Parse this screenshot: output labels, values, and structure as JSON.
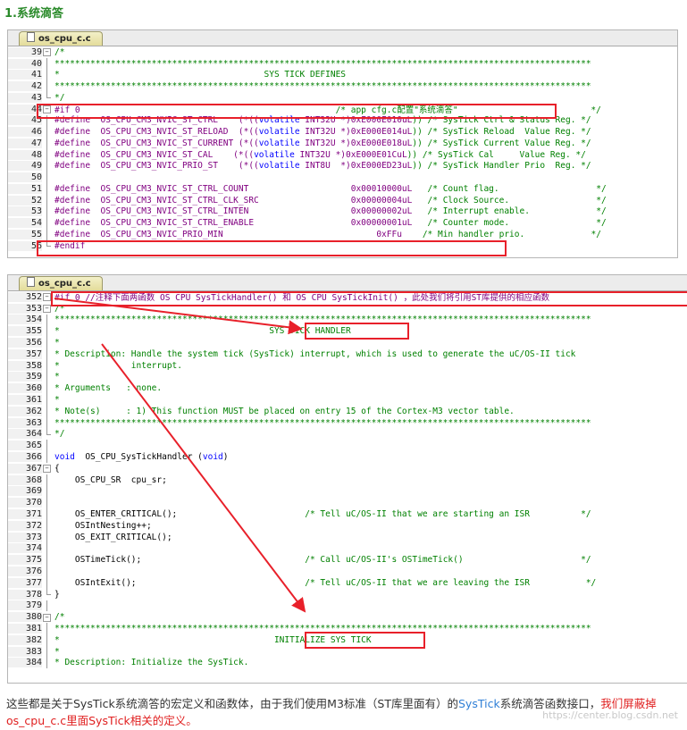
{
  "heading": "1.系统滴答",
  "shot1": {
    "tab_label": "os_cpu_c.c",
    "lines": [
      {
        "n": "39",
        "fold": "box",
        "t": "/*",
        "cls": "c"
      },
      {
        "n": "40",
        "fold": "bar",
        "t": "*********************************************************************************************************",
        "cls": "c"
      },
      {
        "n": "41",
        "fold": "bar",
        "t": "*                                        SYS TICK DEFINES",
        "cls": "c"
      },
      {
        "n": "42",
        "fold": "bar",
        "t": "*********************************************************************************************************",
        "cls": "c"
      },
      {
        "n": "43",
        "fold": "end",
        "t": "*/",
        "cls": "c"
      },
      {
        "n": "44",
        "fold": "box",
        "segs": [
          {
            "t": "#if 0",
            "c": "n"
          },
          {
            "t": "                                                  /* app cfg.c配置\"系统滴答\"                          */",
            "c": "c"
          }
        ]
      },
      {
        "n": "45",
        "fold": "bar",
        "segs": [
          {
            "t": "#define  OS_CPU_CM3_NVIC_ST_CTRL    (*((",
            "c": "n"
          },
          {
            "t": "volatile",
            "c": "k"
          },
          {
            "t": " INT32U *)",
            "c": "n"
          },
          {
            "t": "0xE000E010uL",
            "c": "n"
          },
          {
            "t": ")) /* SysTick Ctrl & Status Reg. */",
            "c": "c"
          }
        ]
      },
      {
        "n": "46",
        "fold": "bar",
        "segs": [
          {
            "t": "#define  OS_CPU_CM3_NVIC_ST_RELOAD  (*((",
            "c": "n"
          },
          {
            "t": "volatile",
            "c": "k"
          },
          {
            "t": " INT32U *)",
            "c": "n"
          },
          {
            "t": "0xE000E014uL",
            "c": "n"
          },
          {
            "t": ")) /* SysTick Reload  Value Reg. */",
            "c": "c"
          }
        ]
      },
      {
        "n": "47",
        "fold": "bar",
        "segs": [
          {
            "t": "#define  OS_CPU_CM3_NVIC_ST_CURRENT (*((",
            "c": "n"
          },
          {
            "t": "volatile",
            "c": "k"
          },
          {
            "t": " INT32U *)",
            "c": "n"
          },
          {
            "t": "0xE000E018uL",
            "c": "n"
          },
          {
            "t": ")) /* SysTick Current Value Reg. */",
            "c": "c"
          }
        ]
      },
      {
        "n": "48",
        "fold": "bar",
        "segs": [
          {
            "t": "#define  OS_CPU_CM3_NVIC_ST_CAL    (*((",
            "c": "n"
          },
          {
            "t": "volatile",
            "c": "k"
          },
          {
            "t": " INT32U *)",
            "c": "n"
          },
          {
            "t": "0xE000E01CuL",
            "c": "n"
          },
          {
            "t": ")) /* SysTick Cal     Value Reg. */",
            "c": "c"
          }
        ]
      },
      {
        "n": "49",
        "fold": "bar",
        "segs": [
          {
            "t": "#define  OS_CPU_CM3_NVIC_PRIO_ST    (*((",
            "c": "n"
          },
          {
            "t": "volatile",
            "c": "k"
          },
          {
            "t": " INT8U  *)",
            "c": "n"
          },
          {
            "t": "0xE000ED23uL",
            "c": "n"
          },
          {
            "t": ")) /* SysTick Handler Prio  Reg. */",
            "c": "c"
          }
        ]
      },
      {
        "n": "50",
        "fold": "bar",
        "t": ""
      },
      {
        "n": "51",
        "fold": "bar",
        "segs": [
          {
            "t": "#define  OS_CPU_CM3_NVIC_ST_CTRL_COUNT                    0x00010000uL",
            "c": "n"
          },
          {
            "t": "   /* Count flag.                   */",
            "c": "c"
          }
        ]
      },
      {
        "n": "52",
        "fold": "bar",
        "segs": [
          {
            "t": "#define  OS_CPU_CM3_NVIC_ST_CTRL_CLK_SRC                  0x00000004uL",
            "c": "n"
          },
          {
            "t": "   /* Clock Source.                 */",
            "c": "c"
          }
        ]
      },
      {
        "n": "53",
        "fold": "bar",
        "segs": [
          {
            "t": "#define  OS_CPU_CM3_NVIC_ST_CTRL_INTEN                    0x00000002uL",
            "c": "n"
          },
          {
            "t": "   /* Interrupt enable.             */",
            "c": "c"
          }
        ]
      },
      {
        "n": "54",
        "fold": "bar",
        "segs": [
          {
            "t": "#define  OS_CPU_CM3_NVIC_ST_CTRL_ENABLE                   0x00000001uL",
            "c": "n"
          },
          {
            "t": "   /* Counter mode.                 */",
            "c": "c"
          }
        ]
      },
      {
        "n": "55",
        "fold": "bar",
        "segs": [
          {
            "t": "#define  OS_CPU_CM3_NVIC_PRIO_MIN                              0xFFu",
            "c": "n"
          },
          {
            "t": "    /* Min handler prio.             */",
            "c": "c"
          }
        ]
      },
      {
        "n": "56",
        "fold": "end",
        "t": "#endif",
        "cls": "n"
      }
    ]
  },
  "shot2": {
    "tab_label": "os_cpu_c.c",
    "lines": [
      {
        "n": "352",
        "fold": "box",
        "segs": [
          {
            "t": "#if 0 //注释下面两函数 OS CPU SysTickHandler() 和 OS CPU SysTickInit() ，此处我们将引用ST库提供的相应函数",
            "c": "n"
          }
        ]
      },
      {
        "n": "353",
        "fold": "box",
        "t": "/*",
        "cls": "c"
      },
      {
        "n": "354",
        "fold": "bar",
        "t": "*********************************************************************************************************",
        "cls": "c"
      },
      {
        "n": "355",
        "fold": "bar",
        "t": "*                                         SYS TICK HANDLER",
        "cls": "c"
      },
      {
        "n": "356",
        "fold": "bar",
        "t": "*",
        "cls": "c"
      },
      {
        "n": "357",
        "fold": "bar",
        "t": "* Description: Handle the system tick (SysTick) interrupt, which is used to generate the uC/OS-II tick",
        "cls": "c"
      },
      {
        "n": "358",
        "fold": "bar",
        "t": "*              interrupt.",
        "cls": "c"
      },
      {
        "n": "359",
        "fold": "bar",
        "t": "*",
        "cls": "c"
      },
      {
        "n": "360",
        "fold": "bar",
        "t": "* Arguments   : none.",
        "cls": "c"
      },
      {
        "n": "361",
        "fold": "bar",
        "t": "*",
        "cls": "c"
      },
      {
        "n": "362",
        "fold": "bar",
        "t": "* Note(s)     : 1) This function MUST be placed on entry 15 of the Cortex-M3 vector table.",
        "cls": "c"
      },
      {
        "n": "363",
        "fold": "bar",
        "t": "*********************************************************************************************************",
        "cls": "c"
      },
      {
        "n": "364",
        "fold": "end",
        "t": "*/",
        "cls": "c"
      },
      {
        "n": "365",
        "fold": "bar",
        "t": ""
      },
      {
        "n": "366",
        "fold": "bar",
        "segs": [
          {
            "t": "void",
            "c": "k"
          },
          {
            "t": "  OS_CPU_SysTickHandler (",
            "c": ""
          },
          {
            "t": "void",
            "c": "k"
          },
          {
            "t": ")",
            "c": ""
          }
        ]
      },
      {
        "n": "367",
        "fold": "box",
        "t": "{"
      },
      {
        "n": "368",
        "fold": "bar",
        "t": "    OS_CPU_SR  cpu_sr;"
      },
      {
        "n": "369",
        "fold": "bar",
        "t": ""
      },
      {
        "n": "370",
        "fold": "bar",
        "t": ""
      },
      {
        "n": "371",
        "fold": "bar",
        "segs": [
          {
            "t": "    OS_ENTER_CRITICAL();                         ",
            "c": ""
          },
          {
            "t": "/* Tell uC/OS-II that we are starting an ISR          */",
            "c": "c"
          }
        ]
      },
      {
        "n": "372",
        "fold": "bar",
        "t": "    OSIntNesting++;"
      },
      {
        "n": "373",
        "fold": "bar",
        "t": "    OS_EXIT_CRITICAL();"
      },
      {
        "n": "374",
        "fold": "bar",
        "t": ""
      },
      {
        "n": "375",
        "fold": "bar",
        "segs": [
          {
            "t": "    OSTimeTick();                                ",
            "c": ""
          },
          {
            "t": "/* Call uC/OS-II's OSTimeTick()                       */",
            "c": "c"
          }
        ]
      },
      {
        "n": "376",
        "fold": "bar",
        "t": ""
      },
      {
        "n": "377",
        "fold": "bar",
        "segs": [
          {
            "t": "    OSIntExit();                                 ",
            "c": ""
          },
          {
            "t": "/* Tell uC/OS-II that we are leaving the ISR           */",
            "c": "c"
          }
        ]
      },
      {
        "n": "378",
        "fold": "end",
        "t": "}"
      },
      {
        "n": "379",
        "fold": "bar",
        "t": ""
      },
      {
        "n": "380",
        "fold": "box",
        "t": "/*",
        "cls": "c"
      },
      {
        "n": "381",
        "fold": "bar",
        "t": "*********************************************************************************************************",
        "cls": "c"
      },
      {
        "n": "382",
        "fold": "bar",
        "t": "*                                          INITIALIZE SYS TICK",
        "cls": "c"
      },
      {
        "n": "383",
        "fold": "bar",
        "t": "*",
        "cls": "c"
      },
      {
        "n": "384",
        "fold": "bar",
        "t": "* Description: Initialize the SysTick.",
        "cls": "c"
      }
    ]
  },
  "paragraph": {
    "p1": "这些都是关于SysTick系统滴答的宏定义和函数体，由于我们使用M3标准（ST库里面有）的",
    "link": "SysTick",
    "p2": "系统滴答函数接口，",
    "red": "我们屏蔽掉os_cpu_c.c里面SysTick相关的定义。"
  },
  "watermark": "https://center.blog.csdn.net",
  "colors": {
    "accent_red": "#e8202a",
    "heading_green": "#2a8a2a",
    "link_blue": "#2f7fd6",
    "comment_green": "#008000",
    "keyword_blue": "#0000ff",
    "preproc_purple": "#800080"
  }
}
